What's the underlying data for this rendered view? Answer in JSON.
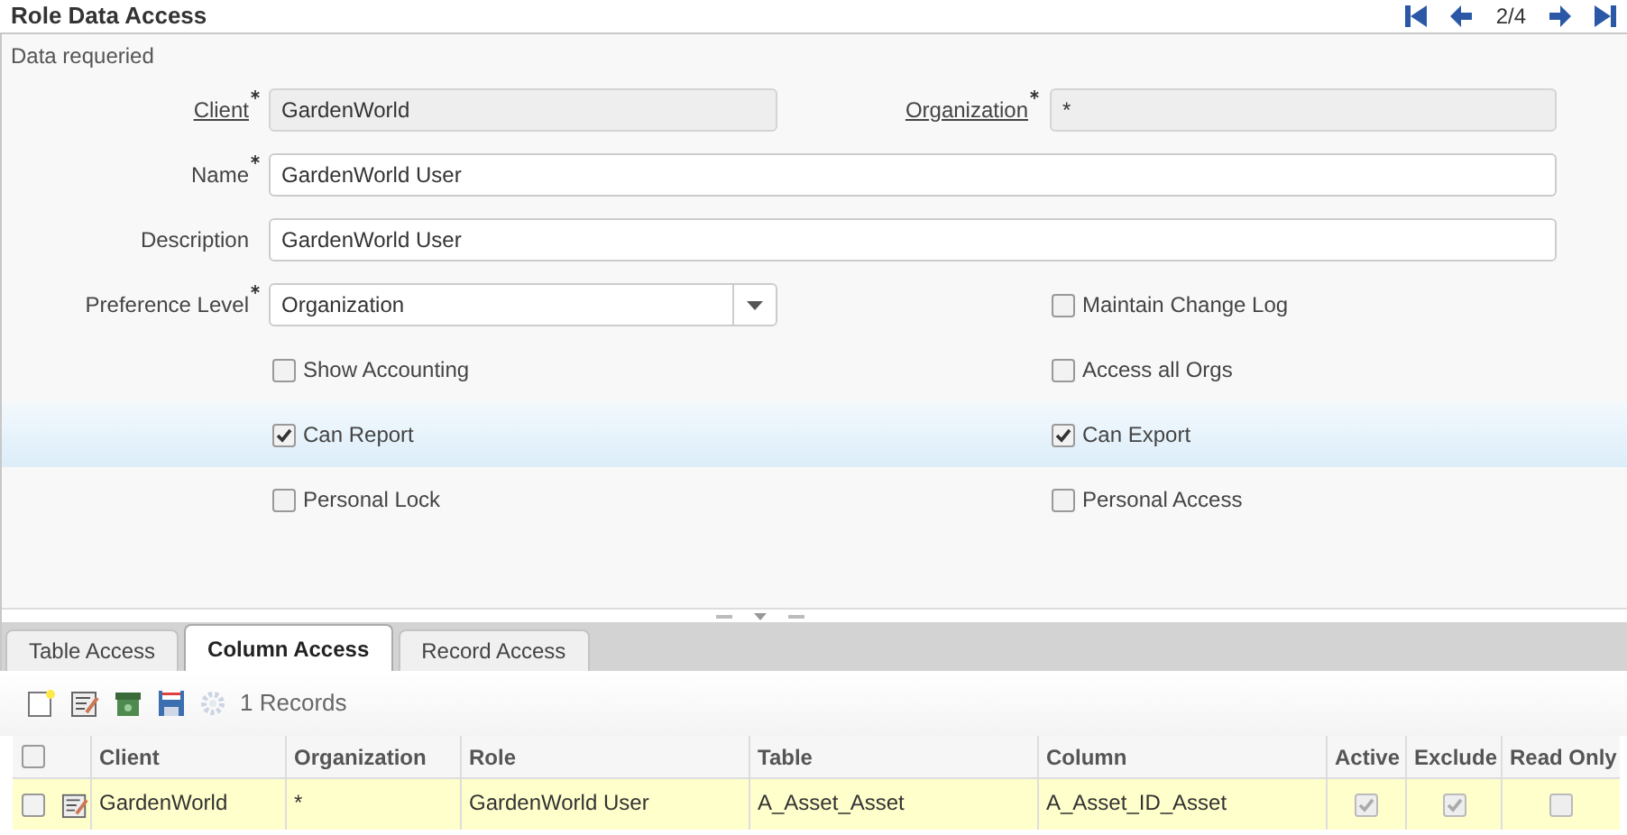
{
  "header": {
    "title": "Role Data Access",
    "position": "2/4"
  },
  "form": {
    "message": "Data requeried",
    "rows": [
      {
        "highlighted": false,
        "items": [
          {
            "kind": "text",
            "label": "Client",
            "required": true,
            "link": true,
            "readonly": true,
            "value": "GardenWorld"
          },
          {
            "kind": "text",
            "label": "Organization",
            "required": true,
            "link": true,
            "readonly": true,
            "value": "*"
          }
        ]
      },
      {
        "highlighted": false,
        "items": [
          {
            "kind": "text",
            "label": "Name",
            "required": true,
            "link": false,
            "readonly": false,
            "value": "GardenWorld User"
          }
        ]
      },
      {
        "highlighted": false,
        "items": [
          {
            "kind": "text",
            "label": "Description",
            "required": false,
            "link": false,
            "readonly": false,
            "value": "GardenWorld User"
          }
        ]
      },
      {
        "highlighted": false,
        "items": [
          {
            "kind": "select",
            "label": "Preference Level",
            "required": true,
            "link": false,
            "value": "Organization"
          },
          {
            "kind": "checkbox",
            "label": "Maintain Change Log",
            "checked": false
          }
        ]
      },
      {
        "highlighted": false,
        "items": [
          {
            "kind": "checkbox",
            "label": "Show Accounting",
            "checked": false
          },
          {
            "kind": "checkbox",
            "label": "Access all Orgs",
            "checked": false
          }
        ]
      },
      {
        "highlighted": true,
        "items": [
          {
            "kind": "checkbox",
            "label": "Can Report",
            "checked": true
          },
          {
            "kind": "checkbox",
            "label": "Can Export",
            "checked": true
          }
        ]
      },
      {
        "highlighted": false,
        "items": [
          {
            "kind": "checkbox",
            "label": "Personal Lock",
            "checked": false
          },
          {
            "kind": "checkbox",
            "label": "Personal Access",
            "checked": false
          }
        ]
      }
    ]
  },
  "tabs": [
    {
      "label": "Table Access",
      "selected": false
    },
    {
      "label": "Column Access",
      "selected": true
    },
    {
      "label": "Record Access",
      "selected": false
    }
  ],
  "toolbar": {
    "record_count": "1 Records"
  },
  "table": {
    "columns": [
      {
        "kind": "select",
        "checked": false
      },
      {
        "label": "Client",
        "kind": "text"
      },
      {
        "label": "Organization",
        "kind": "text"
      },
      {
        "label": "Role",
        "kind": "text"
      },
      {
        "label": "Table",
        "kind": "text"
      },
      {
        "label": "Column",
        "kind": "text"
      },
      {
        "label": "Active",
        "kind": "check"
      },
      {
        "label": "Exclude",
        "kind": "check"
      },
      {
        "label": "Read Only",
        "kind": "check"
      }
    ],
    "rows": [
      {
        "selected": true,
        "cells": [
          false,
          "GardenWorld",
          "*",
          "GardenWorld User",
          "A_Asset_Asset",
          "A_Asset_ID_Asset",
          true,
          true,
          false
        ]
      }
    ]
  }
}
